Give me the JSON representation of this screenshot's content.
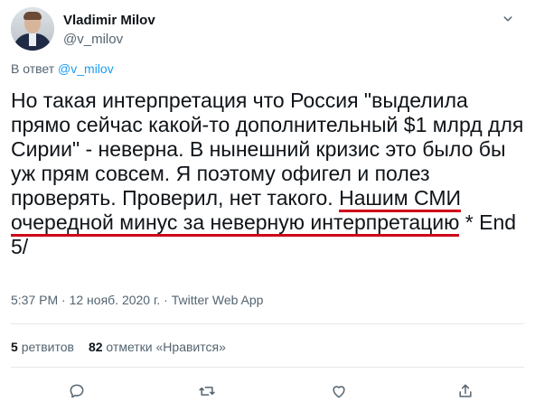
{
  "author": {
    "name": "Vladimir Milov",
    "handle": "@v_milov"
  },
  "reply": {
    "prefix": "В ответ",
    "mention": "@v_milov"
  },
  "tweet": {
    "text_plain": "Но такая интерпретация что Россия \"выделила прямо сейчас какой-то дополнительный $1 млрд для Сирии\" - неверна. В нынешний кризис это было бы уж прям совсем. Я поэтому офигел и полез проверять. Проверил, нет такого. ",
    "text_underlined_1": "Нашим СМИ",
    "text_underlined_2": "очередной минус за неверную интерпретацию",
    "text_tail": " * End 5/",
    "underline_color": "#d0021b"
  },
  "meta": {
    "time": "5:37 PM",
    "sep1": " · ",
    "date": "12 нояб. 2020 г.",
    "sep2": " · ",
    "source": "Twitter Web App"
  },
  "stats": {
    "retweets_count": "5",
    "retweets_label": "ретвитов",
    "likes_count": "82",
    "likes_label": "отметки «Нравится»"
  },
  "actions": [
    "reply-icon",
    "retweet-icon",
    "like-icon",
    "share-icon"
  ],
  "colors": {
    "accent": "#1d9bf0",
    "secondary_text": "#536471",
    "primary_text": "#0f1419"
  }
}
